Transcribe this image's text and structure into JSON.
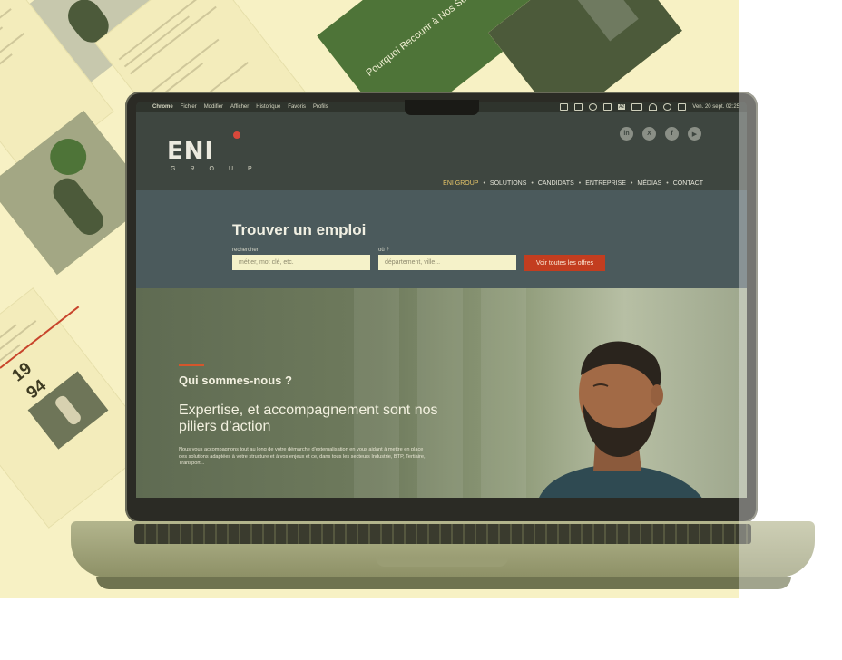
{
  "collage": {
    "year_top": "19",
    "year_bottom": "94",
    "banner": "Pourquoi Recourir à Nos Services ?"
  },
  "menubar": {
    "app": "Chrome",
    "items": [
      "Fichier",
      "Modifier",
      "Afficher",
      "Historique",
      "Favoris",
      "Profils"
    ],
    "input_badge": "A2",
    "datetime": "Ven. 20 sept.  02:25"
  },
  "header": {
    "logo_word": "ENI",
    "logo_sub": "GROUP",
    "socials": [
      "in",
      "X",
      "f",
      "▶"
    ],
    "nav": [
      {
        "label": "ENI GROUP",
        "active": true
      },
      {
        "label": "SOLUTIONS"
      },
      {
        "label": "CANDIDATS"
      },
      {
        "label": "ENTREPRISE"
      },
      {
        "label": "MÉDIAS"
      },
      {
        "label": "CONTACT"
      }
    ]
  },
  "search": {
    "title": "Trouver un emploi",
    "what_label": "rechercher",
    "what_placeholder": "métier, mot clé, etc.",
    "where_label": "où ?",
    "where_placeholder": "département, ville...",
    "cta": "Voir toutes les offres"
  },
  "hero": {
    "kicker": "Qui sommes-nous ?",
    "title": "Expertise, et accompagnement sont nos piliers d’action",
    "body": "Nous vous accompagnons tout au long de votre démarche d'externalisation en vous aidant à mettre en place des solutions adaptées à votre structure et à vos enjeux et ce, dans tous les secteurs Industrie, BTP, Tertiaire, Transport..."
  },
  "colors": {
    "accent_red": "#c33d1f",
    "nav_active": "#e9c86a",
    "header_bg": "#3e4640",
    "search_bg": "#4b5a5c"
  }
}
